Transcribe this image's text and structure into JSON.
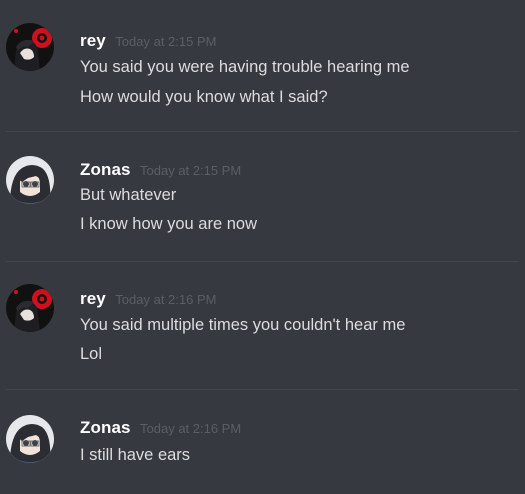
{
  "theme": {
    "background": "#36393f",
    "username_color": "#ffffff",
    "text_color": "#dcddde",
    "timestamp_color": "#5b5e63",
    "rey_avatar_accent": "#d0101e",
    "zonas_avatar_bg": "#e6e8ec"
  },
  "messages": [
    {
      "author": "rey",
      "timestamp": "Today at 2:15 PM",
      "avatar_icon": "rey-avatar-icon",
      "lines": [
        "You said you were having trouble hearing me",
        "How would you know what I said?"
      ]
    },
    {
      "author": "Zonas",
      "timestamp": "Today at 2:15 PM",
      "avatar_icon": "zonas-avatar-icon",
      "lines": [
        "But whatever",
        "I know how you are now"
      ]
    },
    {
      "author": "rey",
      "timestamp": "Today at 2:16 PM",
      "avatar_icon": "rey-avatar-icon",
      "lines": [
        "You said multiple times you couldn't hear me",
        "Lol"
      ]
    },
    {
      "author": "Zonas",
      "timestamp": "Today at 2:16 PM",
      "avatar_icon": "zonas-avatar-icon",
      "lines": [
        "I still have ears"
      ]
    }
  ]
}
